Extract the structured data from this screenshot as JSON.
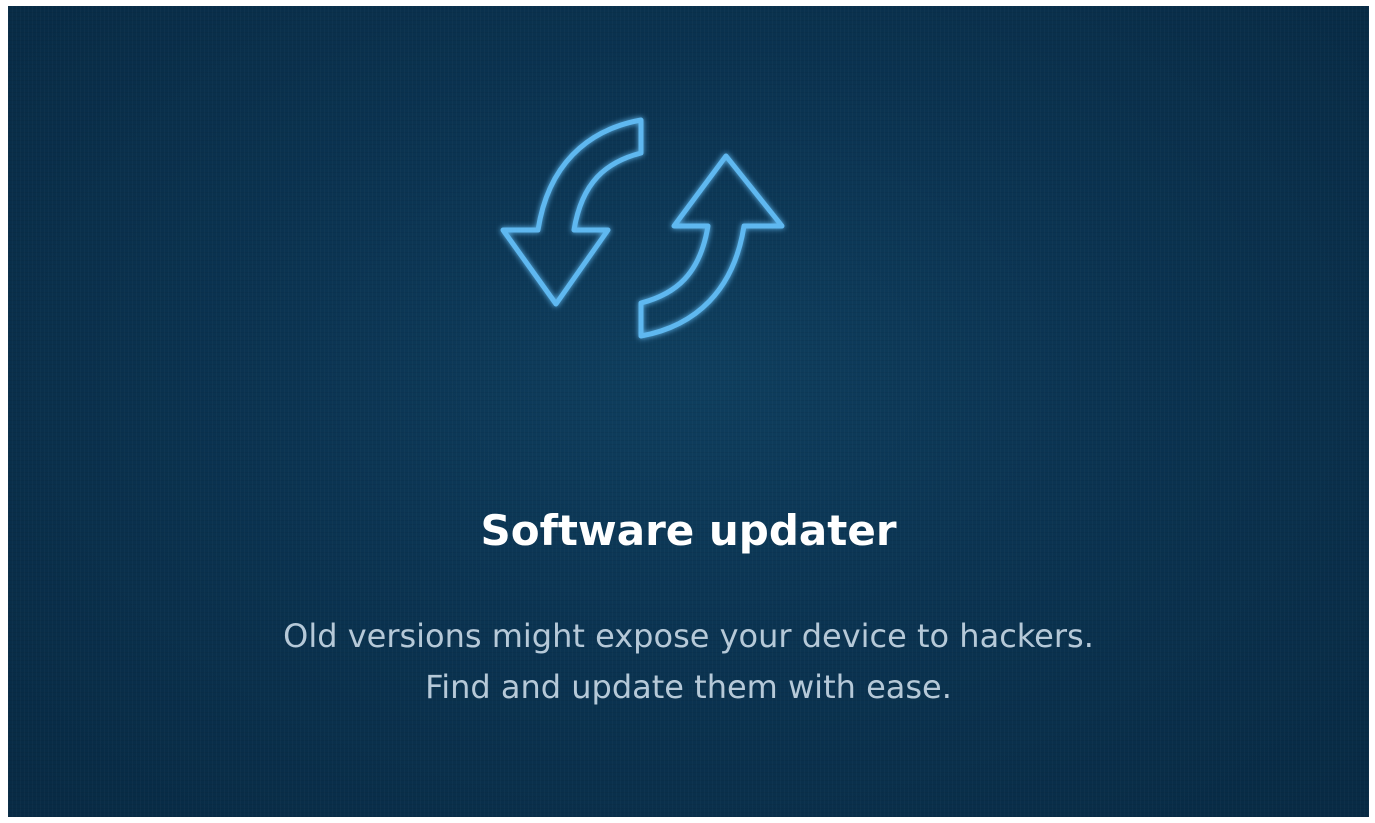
{
  "screen": {
    "title": "Software updater",
    "description_lines": [
      "Old versions might expose your device to hackers.",
      "Find and update them with ease."
    ],
    "icon": "refresh-arrows-icon",
    "colors": {
      "background": "#0b3452",
      "icon_stroke": "#5fb8f0",
      "title": "#ffffff",
      "description": "#b6c9d8"
    }
  }
}
